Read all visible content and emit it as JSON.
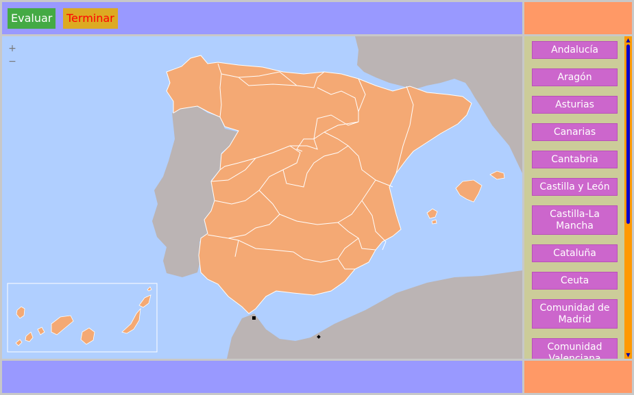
{
  "toolbar": {
    "evaluate_label": "Evaluar",
    "finish_label": "Terminar"
  },
  "map": {
    "zoom_in": "+",
    "zoom_out": "−"
  },
  "regions": [
    "Andalucía",
    "Aragón",
    "Asturias",
    "Canarias",
    "Cantabria",
    "Castilla y León",
    "Castilla-La Mancha",
    "Cataluña",
    "Ceuta",
    "Comunidad de Madrid",
    "Comunidad Valenciana"
  ],
  "colors": {
    "header_bar": "#9999ff",
    "corner_panel": "#ff9966",
    "sea": "#b0cfff",
    "spain_land": "#f4a974",
    "foreign_land": "#bbb4b4",
    "region_button": "#cc66cc",
    "panel": "#cccc99",
    "scrollbar": "#ff9900",
    "scroll_thumb": "#0000cc",
    "evaluate_button": "#44aa44",
    "finish_button": "#ddaa22",
    "finish_text": "#ff0000"
  }
}
